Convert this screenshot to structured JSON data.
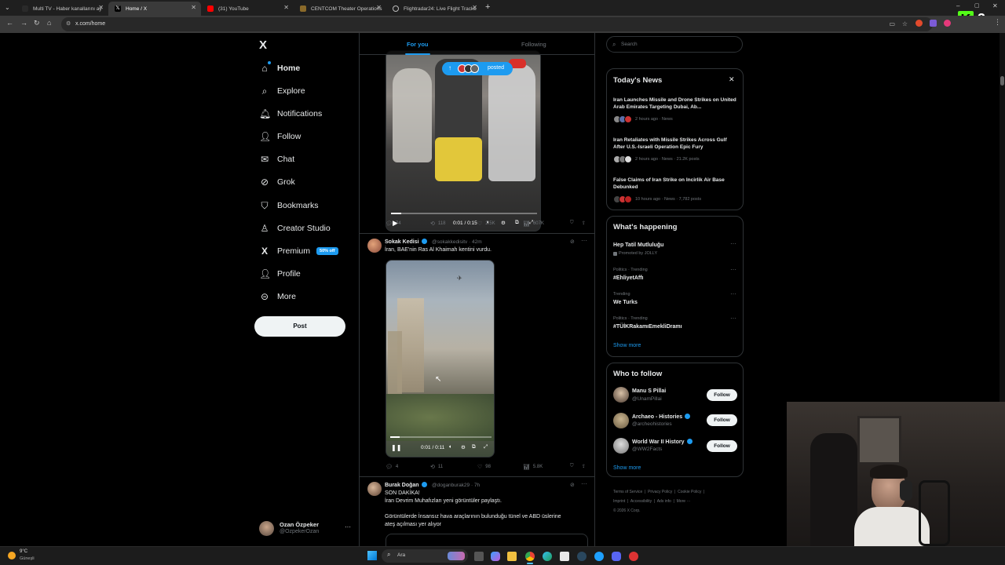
{
  "browser": {
    "tabs": [
      {
        "title": "Multi TV - Haber kanallarını ay"
      },
      {
        "title": "Home / X"
      },
      {
        "title": "(31) YouTube"
      },
      {
        "title": "CENTCOM Theater Operations"
      },
      {
        "title": "Flightradar24: Live Flight Tracke"
      }
    ],
    "url": "x.com/home",
    "overlay_badge": "3"
  },
  "sidebar": {
    "logo": "X",
    "items": [
      {
        "label": "Home",
        "icon": "home-icon"
      },
      {
        "label": "Explore",
        "icon": "search-icon"
      },
      {
        "label": "Notifications",
        "icon": "bell-icon"
      },
      {
        "label": "Follow",
        "icon": "person-add-icon"
      },
      {
        "label": "Chat",
        "icon": "mail-icon"
      },
      {
        "label": "Grok",
        "icon": "grok-icon"
      },
      {
        "label": "Bookmarks",
        "icon": "bookmark-icon"
      },
      {
        "label": "Creator Studio",
        "icon": "creator-icon"
      },
      {
        "label": "Premium",
        "icon": "x-icon"
      },
      {
        "label": "Profile",
        "icon": "profile-icon"
      },
      {
        "label": "More",
        "icon": "more-circle-icon"
      }
    ],
    "premium_badge": "50% off",
    "post_label": "Post",
    "account": {
      "name": "Ozan Özpeker",
      "handle": "@OzpekerOzan"
    }
  },
  "feed": {
    "tabs": {
      "for_you": "For you",
      "following": "Following"
    },
    "posted_pill": "posted",
    "post1": {
      "video_time": "0:01 / 0:15",
      "progress": 0.07,
      "stats": {
        "replies": "74",
        "reposts": "118",
        "likes": "2.5K",
        "views": "607K"
      }
    },
    "post2": {
      "name": "Sokak Kedisi",
      "handle": "@sokakkedisitv · 42m",
      "text": "İran, BAE'nin Ras Al Khaimah kentini vurdu.",
      "video_time": "0:01 / 0:11",
      "progress": 0.09,
      "stats": {
        "replies": "4",
        "reposts": "11",
        "likes": "98",
        "views": "5.8K"
      }
    },
    "post3": {
      "name": "Burak Doğan",
      "handle": "@doganburak29 · 7h",
      "line1": "SON DAKİKA!",
      "line2": "İran Devrim Muhafızları yeni görüntüler paylaştı.",
      "line3": "Görüntülerde İnsansız hava araçlarının bulunduğu tünel ve ABD üslerine",
      "line4": "ateş açılması yer alıyor"
    }
  },
  "right": {
    "search_placeholder": "Search",
    "todays_news": {
      "title": "Today's News",
      "items": [
        {
          "headline": "Iran Launches Missile and Drone Strikes on United Arab Emirates Targeting Dubai, Ab...",
          "meta": "2 hours ago · News"
        },
        {
          "headline": "Iran Retaliates with Missile Strikes Across Gulf After U.S.-Israeli Operation Epic Fury",
          "meta": "2 hours ago · News · 21.2K posts"
        },
        {
          "headline": "False Claims of Iran Strike on Incirlik Air Base Debunked",
          "meta": "10 hours ago · News · 7,782 posts"
        }
      ]
    },
    "whats_happening": {
      "title": "What's happening",
      "items": [
        {
          "category": "",
          "name": "Hep Tatil Mutluluğu",
          "sub": "Promoted by JOLLY"
        },
        {
          "category": "Politics · Trending",
          "name": "#EhliyetAffı",
          "sub": ""
        },
        {
          "category": "Trending",
          "name": "We Turks",
          "sub": ""
        },
        {
          "category": "Politics · Trending",
          "name": "#TÜİKRakamıEmekliDramı",
          "sub": ""
        }
      ],
      "show_more": "Show more"
    },
    "who_to_follow": {
      "title": "Who to follow",
      "items": [
        {
          "name": "Manu S Pillai",
          "handle": "@UnamPillai",
          "button": "Follow"
        },
        {
          "name": "Archaeo - Histories",
          "handle": "@archeohistories",
          "button": "Follow"
        },
        {
          "name": "World War II History",
          "handle": "@WW2Facts",
          "button": "Follow"
        }
      ],
      "show_more": "Show more"
    },
    "footer": [
      "Terms of Service",
      "Privacy Policy",
      "Cookie Policy",
      "Imprint",
      "Accessibility",
      "Ads info",
      "More ···",
      "© 2026 X Corp."
    ]
  },
  "taskbar": {
    "weather_temp": "9°C",
    "weather_desc": "Güneşli",
    "search_label": "Ara"
  },
  "colors": {
    "accent": "#1d9bf0",
    "background": "#000000",
    "border": "#2f3336"
  }
}
